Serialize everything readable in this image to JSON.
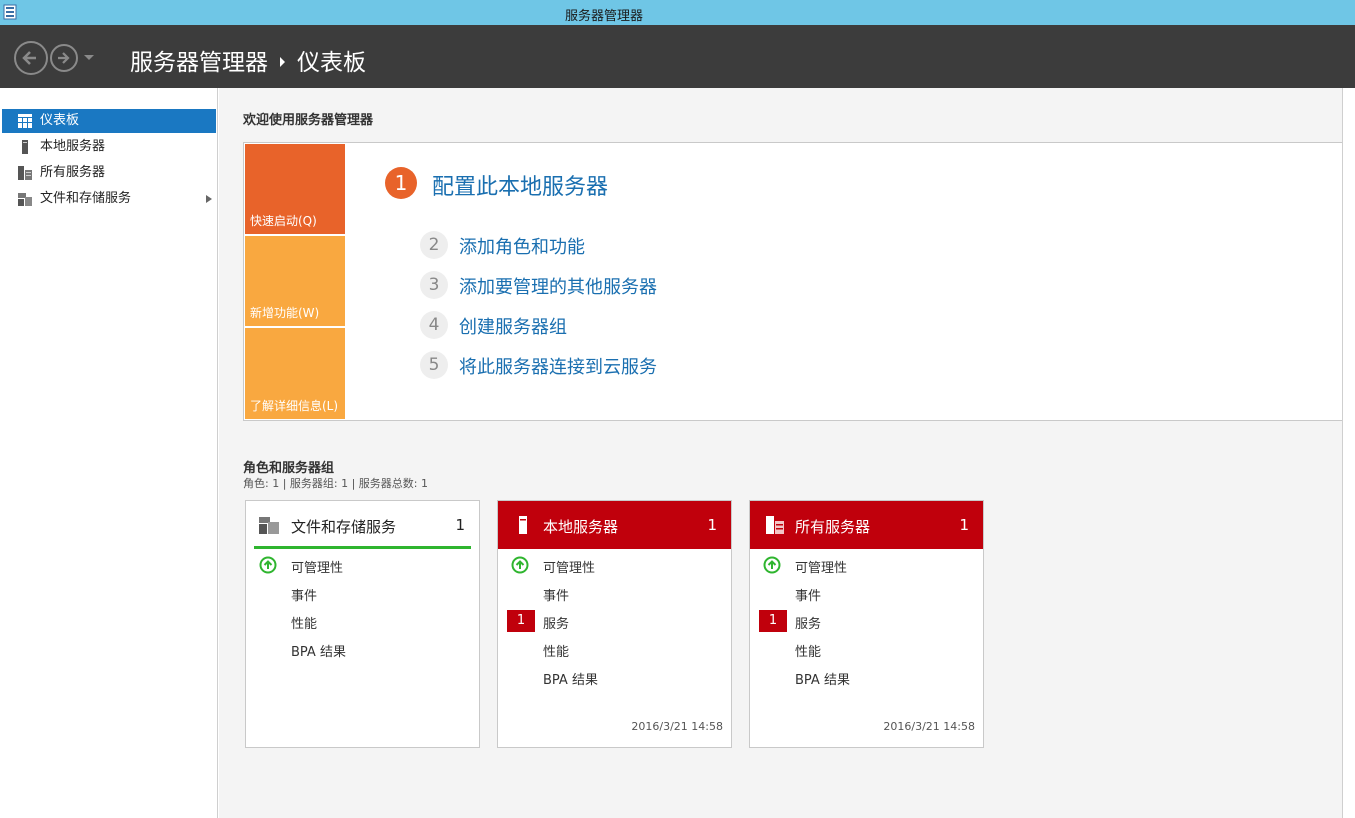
{
  "window": {
    "title": "服务器管理器"
  },
  "header": {
    "breadcrumb_root": "服务器管理器",
    "breadcrumb_current": "仪表板"
  },
  "sidebar": {
    "items": [
      {
        "label": "仪表板",
        "icon": "dashboard-icon",
        "active": true
      },
      {
        "label": "本地服务器",
        "icon": "local-server-icon",
        "active": false
      },
      {
        "label": "所有服务器",
        "icon": "all-servers-icon",
        "active": false
      },
      {
        "label": "文件和存储服务",
        "icon": "file-storage-icon",
        "active": false,
        "has_submenu": true
      }
    ]
  },
  "welcome": {
    "title": "欢迎使用服务器管理器",
    "tiles": [
      "快速启动(Q)",
      "新增功能(W)",
      "了解详细信息(L)"
    ],
    "steps": [
      {
        "num": "1",
        "label": "配置此本地服务器"
      },
      {
        "num": "2",
        "label": "添加角色和功能"
      },
      {
        "num": "3",
        "label": "添加要管理的其他服务器"
      },
      {
        "num": "4",
        "label": "创建服务器组"
      },
      {
        "num": "5",
        "label": "将此服务器连接到云服务"
      }
    ]
  },
  "roles": {
    "title": "角色和服务器组",
    "subtitle": "角色: 1 | 服务器组: 1 | 服务器总数: 1",
    "cards": [
      {
        "title": "文件和存储服务",
        "count": "1",
        "status": "ok",
        "rows": [
          "可管理性",
          "事件",
          "性能",
          "BPA 结果"
        ],
        "timestamp": ""
      },
      {
        "title": "本地服务器",
        "count": "1",
        "status": "alert",
        "rows": [
          "可管理性",
          "事件",
          "服务",
          "性能",
          "BPA 结果"
        ],
        "service_alert": "1",
        "timestamp": "2016/3/21 14:58"
      },
      {
        "title": "所有服务器",
        "count": "1",
        "status": "alert",
        "rows": [
          "可管理性",
          "事件",
          "服务",
          "性能",
          "BPA 结果"
        ],
        "service_alert": "1",
        "timestamp": "2016/3/21 14:58"
      }
    ]
  },
  "colors": {
    "titlebar": "#6fc6e6",
    "header": "#3c3c3c",
    "accent_blue": "#1a78c2",
    "quickstart_orange": "#e8632a",
    "tile_orange": "#f9a840",
    "alert_red": "#c0000c",
    "ok_green": "#2fb52f"
  }
}
